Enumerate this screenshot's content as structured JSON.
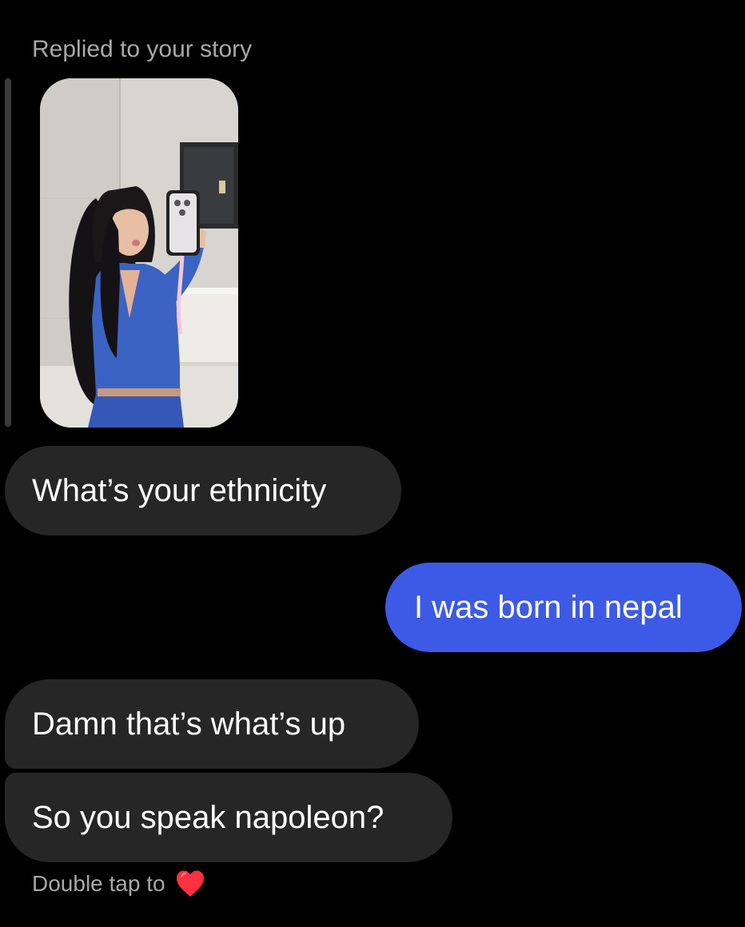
{
  "thread": {
    "reply_context": "Replied to your story",
    "story_thumbnail": "story-photo"
  },
  "messages": [
    {
      "direction": "received",
      "text": "What’s your ethnicity"
    },
    {
      "direction": "sent",
      "text": "I was born in nepal"
    },
    {
      "direction": "received",
      "text": "Damn that’s what’s up"
    },
    {
      "direction": "received",
      "text": "So you speak napoleon?"
    }
  ],
  "footer": {
    "hint": "Double tap to",
    "icon": "heart-icon"
  },
  "colors": {
    "background": "#000000",
    "received_bubble": "#262626",
    "sent_bubble": "#3d5ae6",
    "muted_text": "#a8a8a8",
    "heart": "#ff3040"
  }
}
